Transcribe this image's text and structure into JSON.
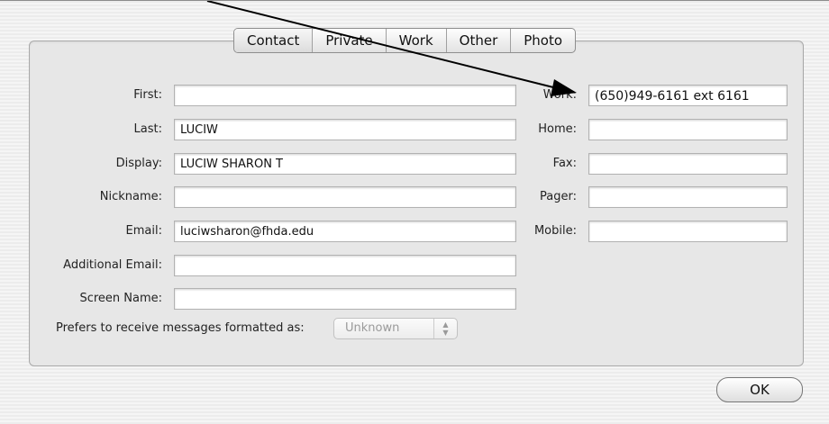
{
  "tabs": [
    "Contact",
    "Private",
    "Work",
    "Other",
    "Photo"
  ],
  "left_fields": {
    "first": {
      "label": "First:",
      "value": ""
    },
    "last": {
      "label": "Last:",
      "value": "LUCIW"
    },
    "display": {
      "label": "Display:",
      "value": "LUCIW SHARON T"
    },
    "nickname": {
      "label": "Nickname:",
      "value": ""
    },
    "email": {
      "label": "Email:",
      "value": "luciwsharon@fhda.edu"
    },
    "additional_email": {
      "label": "Additional Email:",
      "value": ""
    },
    "screen_name": {
      "label": "Screen Name:",
      "value": ""
    }
  },
  "right_fields": {
    "work": {
      "label": "Work:",
      "value": "(650)949-6161 ext 6161"
    },
    "home": {
      "label": "Home:",
      "value": ""
    },
    "fax": {
      "label": "Fax:",
      "value": ""
    },
    "pager": {
      "label": "Pager:",
      "value": ""
    },
    "mobile": {
      "label": "Mobile:",
      "value": ""
    }
  },
  "format": {
    "label": "Prefers to receive messages formatted as:",
    "selected": "Unknown"
  },
  "ok_label": "OK",
  "annotation": {
    "color": "#000000"
  }
}
